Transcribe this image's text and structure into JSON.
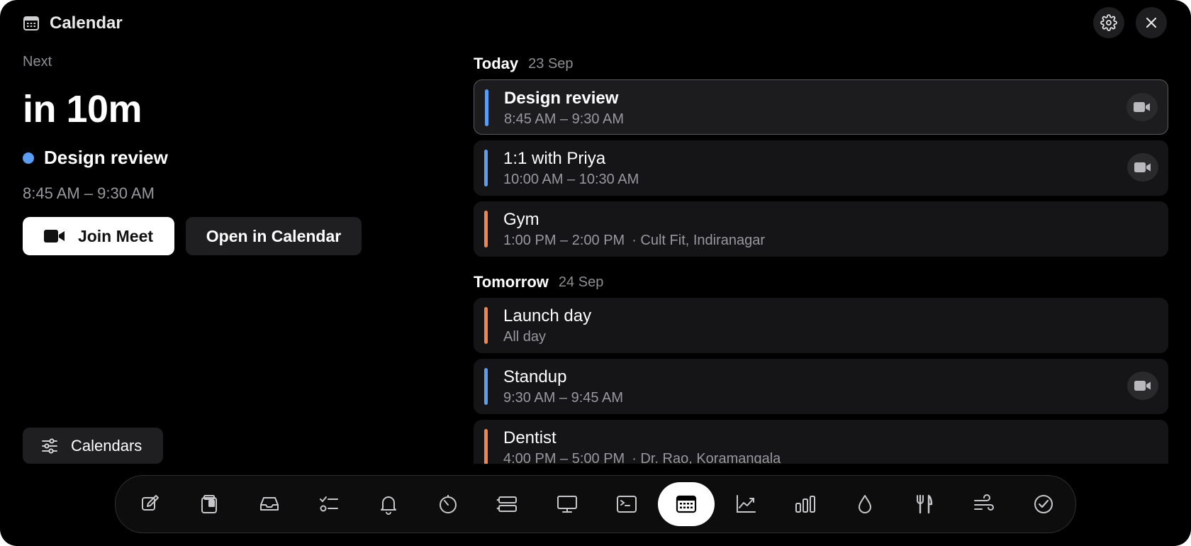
{
  "window": {
    "title": "Calendar",
    "icons": {
      "app": "calendar-icon",
      "settings": "gear-icon",
      "close": "close-icon"
    }
  },
  "next": {
    "label": "Next",
    "countdown": "in 10m",
    "event_name": "Design review",
    "event_color": "#5b9cf5",
    "time": "8:45 AM – 9:30 AM",
    "join_label": "Join Meet",
    "open_label": "Open in Calendar"
  },
  "calendars_button": {
    "label": "Calendars",
    "icon": "sliders-icon"
  },
  "days": [
    {
      "label": "Today",
      "date": "23 Sep",
      "events": [
        {
          "title": "Design review",
          "time": "8:45 AM – 9:30 AM",
          "location": "",
          "color": "#5b9cf5",
          "video": true,
          "selected": true
        },
        {
          "title": "1:1 with Priya",
          "time": "10:00 AM – 10:30 AM",
          "location": "",
          "color": "#5b9cf5",
          "video": true,
          "selected": false
        },
        {
          "title": "Gym",
          "time": "1:00 PM – 2:00 PM",
          "location": "· Cult Fit, Indiranagar",
          "color": "#f5834f",
          "video": false,
          "selected": false
        }
      ]
    },
    {
      "label": "Tomorrow",
      "date": "24 Sep",
      "events": [
        {
          "title": "Launch day",
          "time": "All day",
          "location": "",
          "color": "#f5834f",
          "video": false,
          "selected": false
        },
        {
          "title": "Standup",
          "time": "9:30 AM – 9:45 AM",
          "location": "",
          "color": "#5b9cf5",
          "video": true,
          "selected": false
        },
        {
          "title": "Dentist",
          "time": "4:00 PM – 5:00 PM",
          "location": "· Dr. Rao, Koramangala",
          "color": "#f5834f",
          "video": false,
          "selected": false
        }
      ]
    }
  ],
  "dock": {
    "items": [
      {
        "name": "compose-icon",
        "active": false
      },
      {
        "name": "clipboard-icon",
        "active": false
      },
      {
        "name": "inbox-icon",
        "active": false
      },
      {
        "name": "checklist-icon",
        "active": false
      },
      {
        "name": "bell-icon",
        "active": false
      },
      {
        "name": "timer-icon",
        "active": false
      },
      {
        "name": "list-icon",
        "active": false
      },
      {
        "name": "monitor-icon",
        "active": false
      },
      {
        "name": "terminal-icon",
        "active": false
      },
      {
        "name": "calendar-icon",
        "active": true
      },
      {
        "name": "stocks-chart-icon",
        "active": false
      },
      {
        "name": "bar-chart-icon",
        "active": false
      },
      {
        "name": "water-drop-icon",
        "active": false
      },
      {
        "name": "fork-knife-icon",
        "active": false
      },
      {
        "name": "wind-icon",
        "active": false
      },
      {
        "name": "check-circle-icon",
        "active": false
      }
    ]
  }
}
